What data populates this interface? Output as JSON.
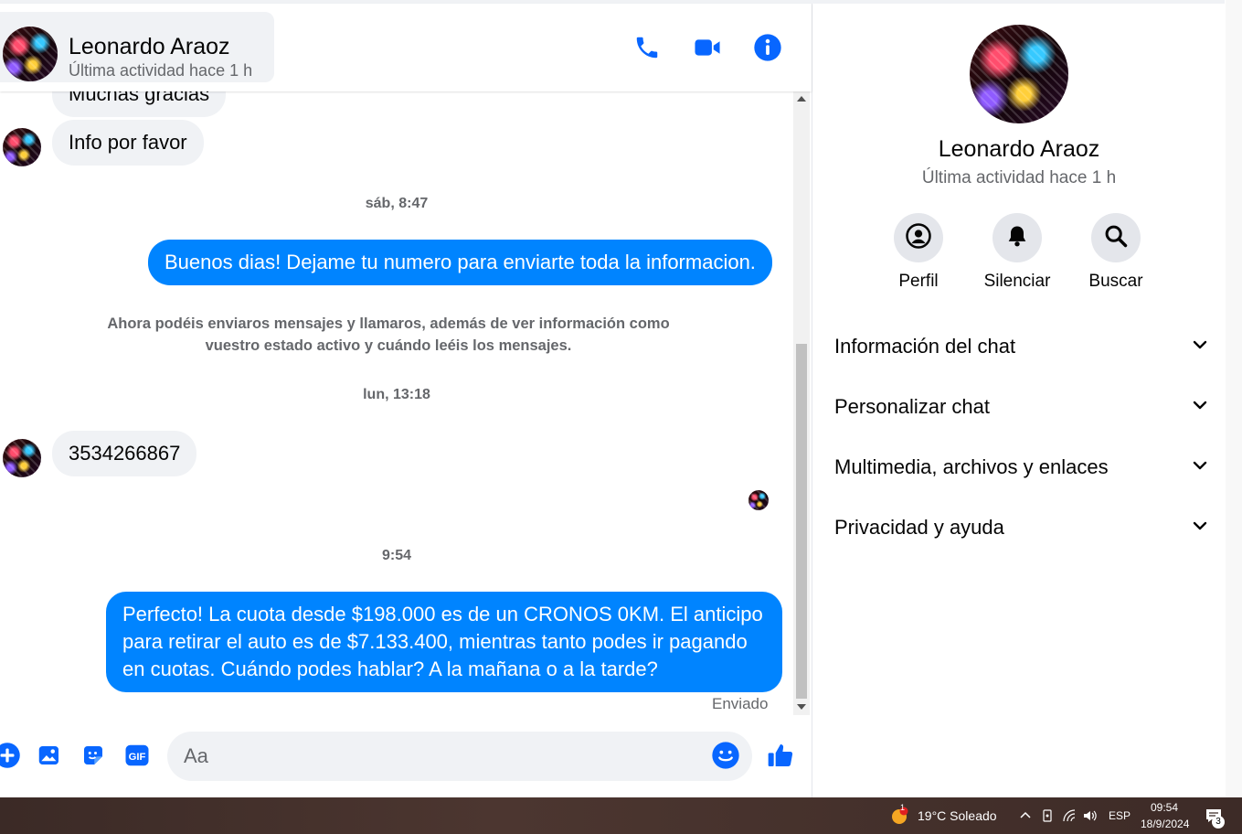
{
  "header": {
    "contact_name": "Leonardo Araoz",
    "last_active": "Última actividad hace 1 h",
    "icons": [
      "phone-icon",
      "video-camera-icon",
      "info-icon"
    ]
  },
  "messages": {
    "partial_top": "Muchas gracias",
    "info_request": "Info por favor",
    "stamp_sat": "sáb, 8:47",
    "out_1": "Buenos dias! Dejame tu numero para enviarte toda la informacion.",
    "system_line1": "Ahora podéis enviaros mensajes y llamaros, además de ver información como",
    "system_line2": "vuestro estado activo y cuándo leéis los mensajes.",
    "stamp_mon": "lun, 13:18",
    "phone_number": "3534266867",
    "stamp_time": "9:54",
    "out_2_line1": "Perfecto! La cuota desde $198.000 es de un CRONOS 0KM. El anticipo",
    "out_2_line2": "para retirar el auto es de $7.133.400, mientras tanto podes ir pagando",
    "out_2_line3": "en cuotas. Cuándo podes hablar? A la mañana o a la tarde?",
    "sent_status": "Enviado"
  },
  "composer": {
    "placeholder": "Aa",
    "gif_label": "GIF"
  },
  "right_panel": {
    "name": "Leonardo Araoz",
    "last_active": "Última actividad hace 1 h",
    "actions": [
      {
        "label": "Perfil",
        "icon": "profile-icon"
      },
      {
        "label": "Silenciar",
        "icon": "bell-icon"
      },
      {
        "label": "Buscar",
        "icon": "search-icon"
      }
    ],
    "sections": [
      {
        "label": "Información del chat"
      },
      {
        "label": "Personalizar chat"
      },
      {
        "label": "Multimedia, archivos y enlaces"
      },
      {
        "label": "Privacidad y ayuda"
      }
    ]
  },
  "taskbar": {
    "weather_badge": "1",
    "weather": "19°C  Soleado",
    "language": "ESP",
    "time": "09:54",
    "date": "18/9/2024",
    "notifications": "3"
  },
  "colors": {
    "accent": "#0084ff",
    "icon_blue": "#0866ff",
    "incoming_bubble": "#f0f2f5",
    "secondary_text": "#65676b"
  }
}
